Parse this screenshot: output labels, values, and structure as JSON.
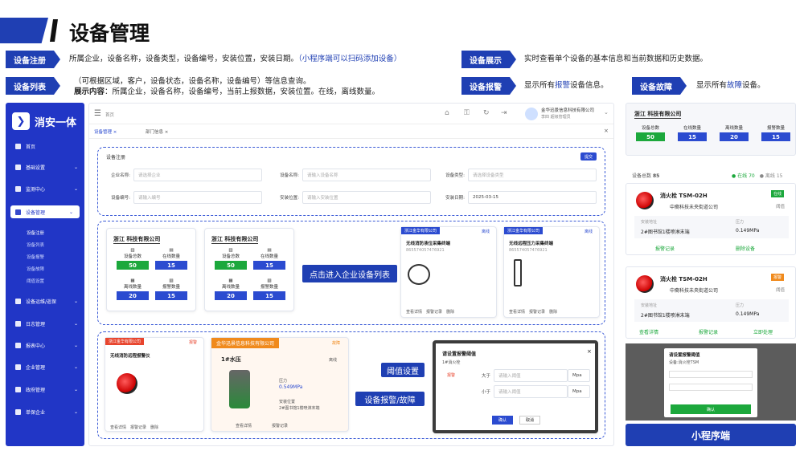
{
  "page": {
    "title": "设备管理"
  },
  "tags": {
    "register": {
      "label": "设备注册",
      "desc": "所属企业，设备名称，设备类型，设备编号，安装位置，安装日期。",
      "desc_blue": "（小程序端可以扫码添加设备）"
    },
    "list": {
      "label": "设备列表",
      "desc1": "（可根据区域，客户，设备状态，设备名称，设备编号）等信息查询。",
      "desc2_bold": "展示内容",
      "desc2": "：所属企业，设备名称，设备编号，当前上报数据，安装位置。在线，离线数量。"
    },
    "display": {
      "label": "设备展示",
      "desc": "实时查看单个设备的基本信息和当前数据和历史数据。"
    },
    "alarm": {
      "label": "设备报警",
      "desc_pre": "显示所有",
      "desc_hl": "报警",
      "desc_post": "设备信息。"
    },
    "fault": {
      "label": "设备故障",
      "desc_pre": "显示所有",
      "desc_hl": "故障",
      "desc_post": "设备。"
    }
  },
  "app": {
    "logo": "消安一体",
    "menu": [
      "首页",
      "基础设置",
      "监测中心",
      "设备管理",
      "设备运维/巡保",
      "日志管理",
      "报表中心",
      "企业管理",
      "政府管理",
      "单保企业"
    ],
    "submenu": [
      "设备注册",
      "设备列表",
      "设备报警",
      "设备故障",
      "阈值设置"
    ],
    "company_user": "金华迅景信息科技有限公司",
    "user": "李四  超级管理员",
    "breadcrumb": "首页",
    "tabs": [
      "设备管理",
      "部门信息"
    ]
  },
  "register_form": {
    "title": "设备注册",
    "btn": "提交",
    "fields": [
      {
        "label": "企业名称:",
        "ph": "请选择企业"
      },
      {
        "label": "设备名称:",
        "ph": "请输入设备名称"
      },
      {
        "label": "设备类型:",
        "ph": "请选择设备类型"
      },
      {
        "label": "设备编号:",
        "ph": "请输入编号"
      },
      {
        "label": "安装位置:",
        "ph": "请输入安装位置"
      },
      {
        "label": "安装日期:",
        "ph": "2025-03-15"
      }
    ]
  },
  "company_cards": [
    {
      "name": "浙江        科技有限公司",
      "stats": [
        {
          "label": "设备总数",
          "val": "50"
        },
        {
          "label": "在线数量",
          "val": "15"
        },
        {
          "label": "离线数量",
          "val": "20"
        },
        {
          "label": "报警数量",
          "val": "15"
        }
      ]
    },
    {
      "name": "浙江        科技有限公司",
      "stats": [
        {
          "label": "设备总数",
          "val": "50"
        },
        {
          "label": "在线数量",
          "val": "15"
        },
        {
          "label": "离线数量",
          "val": "20"
        },
        {
          "label": "报警数量",
          "val": "15"
        }
      ]
    }
  ],
  "callouts": {
    "enter": "点击进入企业设备列表",
    "threshold": "阈值设置",
    "alarm_fault": "设备报警/故障"
  },
  "list_cards": [
    {
      "company": "浙江金华有限公司",
      "tag": "离线",
      "name": "无线消防液位采集终端",
      "id": "865574057476921",
      "actions": [
        "查看详情",
        "报警记录",
        "删除"
      ]
    },
    {
      "company": "浙江金华有限公司",
      "tag": "离线",
      "name": "无线远程压力采集终端",
      "id": "865574057476921",
      "actions": [
        "查看详情",
        "报警记录",
        "删除"
      ]
    }
  ],
  "alarm_card": {
    "company": "浙江金华有限公司",
    "tag": "报警",
    "name": "无线消防远程报警仪",
    "actions": [
      "查看详情",
      "报警记录",
      "删除"
    ]
  },
  "pressure_card": {
    "company": "金华迅景信息科技有限公司",
    "tag": "故障",
    "name": "1#水压",
    "status": "离线",
    "p_label": "压力",
    "p_val": "0.549MPa",
    "loc_label": "安装位置",
    "loc_val": "2#图书馆1楼喷淋末端",
    "actions": [
      "查看详情",
      "报警记录"
    ]
  },
  "threshold_dialog": {
    "title": "请设置报警阈值",
    "device": "1#消火栓",
    "type_label": "报警",
    "rows": [
      {
        "label": "大于",
        "ph": "请输入阈值",
        "unit": "Mpa"
      },
      {
        "label": "小于",
        "ph": "请输入阈值",
        "unit": "Mpa"
      }
    ],
    "ok": "确认",
    "cancel": "取消"
  },
  "mini": {
    "company": "浙江        科技有限公司",
    "stats": [
      {
        "label": "设备总数",
        "val": "50"
      },
      {
        "label": "在线数量",
        "val": "15"
      },
      {
        "label": "离线数量",
        "val": "20"
      },
      {
        "label": "报警数量",
        "val": "15"
      }
    ],
    "total_label": "设备总数",
    "total": "85",
    "online_label": "在线",
    "online": "70",
    "offline_label": "离线",
    "offline": "15",
    "dev1": {
      "name": "消火栓 TSM-02H",
      "status": "在线",
      "company": "中裔科技未央街道公司",
      "action": "阈值",
      "loc_label": "安装地址",
      "loc": "2#图书馆1楼喷淋末端",
      "p_label": "压力",
      "p": "0.149MPa",
      "btn1": "报警记录",
      "btn2": "删除设备"
    },
    "dev2": {
      "name": "消火栓 TSM-02H",
      "status": "报警",
      "company": "中裔科技未央街道公司",
      "action": "阈值",
      "loc_label": "安装地址",
      "loc": "2#图书馆1楼喷淋末端",
      "p_label": "压力",
      "p": "0.149MPa",
      "btn1": "查看详情",
      "btn2": "报警记录",
      "btn3": "立即处理"
    },
    "dialog_title": "请设置报警阈值",
    "dialog_device": "设备:消火栓TSM",
    "dialog_ok": "确认",
    "footer": "小程序端"
  }
}
